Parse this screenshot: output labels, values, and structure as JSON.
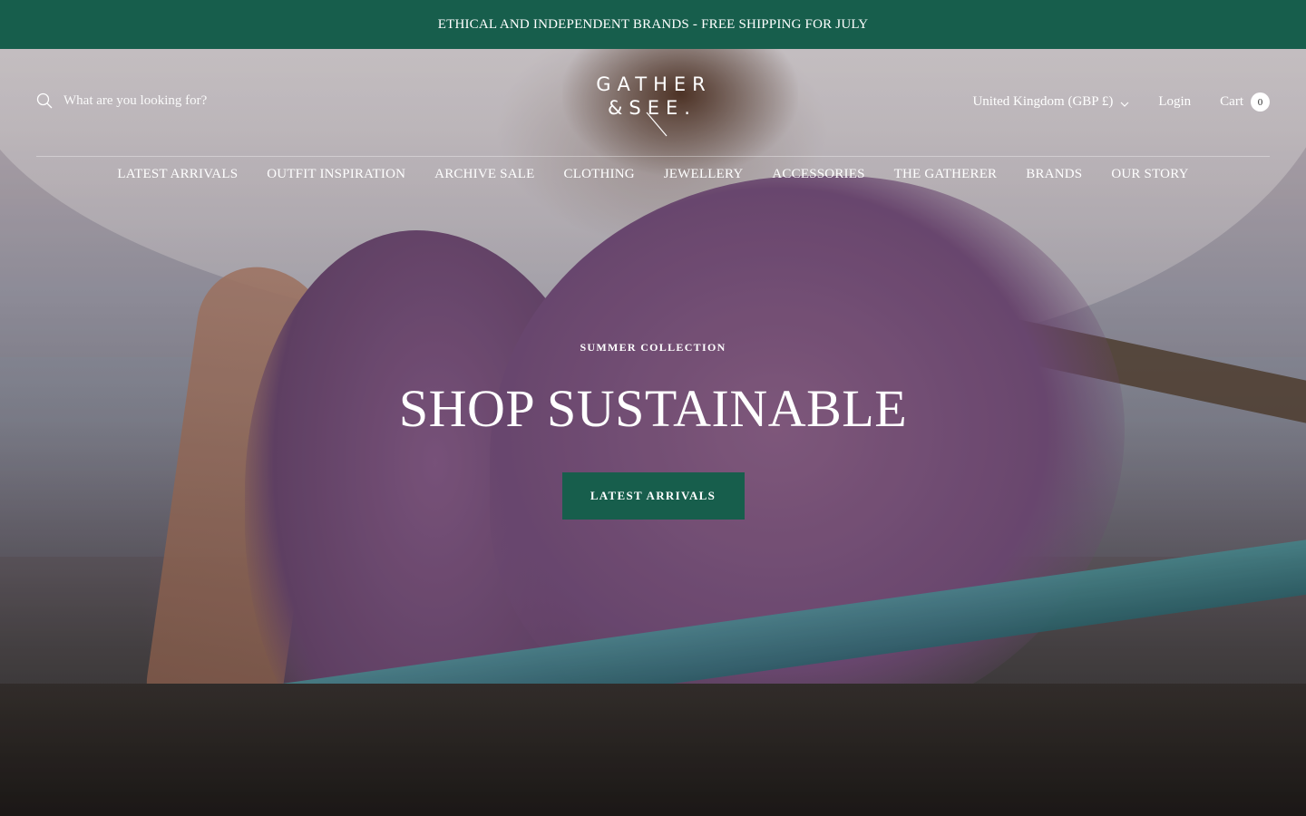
{
  "announcement": {
    "text": "ETHICAL AND INDEPENDENT BRANDS - FREE SHIPPING FOR JULY",
    "background": "#175e4c"
  },
  "header": {
    "search": {
      "placeholder": "What are you looking for?",
      "icon": "search-icon"
    },
    "logo": {
      "line1": "GATHER",
      "line2": "&SEE."
    },
    "currency": {
      "label": "United Kingdom (GBP £)",
      "icon": "chevron-down-icon"
    },
    "login_label": "Login",
    "cart": {
      "label": "Cart",
      "count": "0"
    }
  },
  "nav": {
    "items": [
      {
        "label": "LATEST ARRIVALS"
      },
      {
        "label": "OUTFIT INSPIRATION"
      },
      {
        "label": "ARCHIVE SALE"
      },
      {
        "label": "CLOTHING"
      },
      {
        "label": "JEWELLERY"
      },
      {
        "label": "ACCESSORIES"
      },
      {
        "label": "THE GATHERER"
      },
      {
        "label": "BRANDS"
      },
      {
        "label": "OUR STORY"
      }
    ]
  },
  "hero": {
    "eyebrow": "SUMMER COLLECTION",
    "headline": "SHOP SUSTAINABLE",
    "cta_label": "LATEST ARRIVALS",
    "accent": "#175e4c"
  }
}
